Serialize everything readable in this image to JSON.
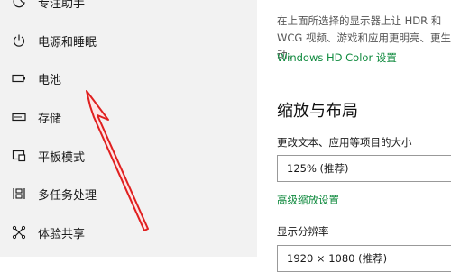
{
  "sidebar": {
    "items": [
      {
        "label": "专注助手",
        "icon": "focus-assist-icon"
      },
      {
        "label": "电源和睡眠",
        "icon": "power-icon"
      },
      {
        "label": "电池",
        "icon": "battery-icon"
      },
      {
        "label": "存储",
        "icon": "storage-icon"
      },
      {
        "label": "平板模式",
        "icon": "tablet-mode-icon"
      },
      {
        "label": "多任务处理",
        "icon": "multitasking-icon"
      },
      {
        "label": "体验共享",
        "icon": "shared-experiences-icon"
      }
    ]
  },
  "content": {
    "hdr_description": "在上面所选择的显示器上让 HDR 和 WCG 视频、游戏和应用更明亮、更生动。",
    "hdr_link": "Windows HD Color 设置",
    "scale_title": "缩放与布局",
    "text_size_label": "更改文本、应用等项目的大小",
    "text_size_value": "125% (推荐)",
    "advanced_scaling_link": "高级缩放设置",
    "resolution_label": "显示分辨率",
    "resolution_value": "1920 × 1080 (推荐)"
  },
  "colors": {
    "link": "#0f8a3e",
    "arrow": "#e02020",
    "sidebar_bg": "#f2f2f2"
  }
}
